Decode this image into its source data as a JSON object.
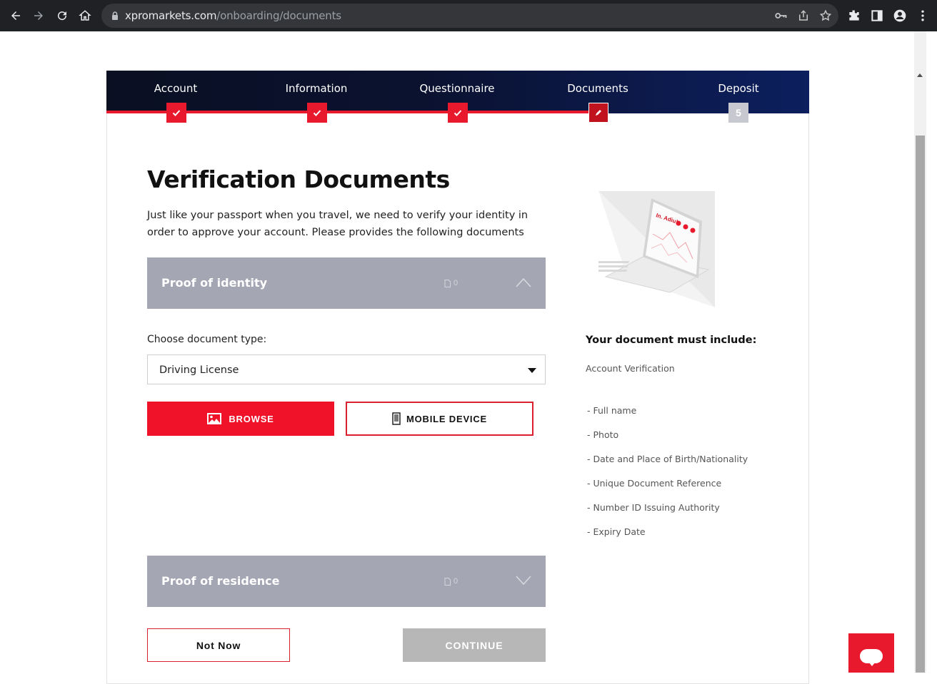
{
  "browser": {
    "url_host": "xpromarkets.com",
    "url_path": "/onboarding/documents"
  },
  "steps": [
    {
      "label": "Account",
      "status": "done"
    },
    {
      "label": "Information",
      "status": "done"
    },
    {
      "label": "Questionnaire",
      "status": "done"
    },
    {
      "label": "Documents",
      "status": "active"
    },
    {
      "label": "Deposit",
      "status": "pending",
      "number": "5"
    }
  ],
  "page": {
    "title": "Verification Documents",
    "intro": "Just like your passport when you travel, we need to verify your identity in order to approve your account. Please provides the following documents"
  },
  "identity": {
    "title": "Proof of identity",
    "count": "0",
    "doc_type_label": "Choose document type:",
    "doc_type_value": "Driving License",
    "browse_label": "BROWSE",
    "mobile_label": "MOBILE DEVICE"
  },
  "residence": {
    "title": "Proof of residence",
    "count": "0"
  },
  "actions": {
    "not_now": "Not Now",
    "continue": "CONTINUE"
  },
  "requirements": {
    "title": "Your document must include:",
    "subtitle": "Account Verification",
    "items": [
      "- Full name",
      "- Photo",
      "- Date and Place of Birth/Nationality",
      "- Unique Document Reference",
      "- Number ID Issuing Authority",
      "- Expiry Date"
    ]
  },
  "colors": {
    "accent": "#e8192c",
    "nav_bg": "#0b1230",
    "accordion_bg": "#a5a6b3",
    "disabled_btn": "#b7b7b7"
  },
  "icons": [
    "back-icon",
    "forward-icon",
    "reload-icon",
    "home-icon",
    "lock-icon",
    "key-icon",
    "share-icon",
    "star-icon",
    "extensions-icon",
    "sidepanel-icon",
    "profile-icon",
    "menu-icon",
    "check-icon",
    "pencil-icon",
    "file-icon",
    "chevron-up-icon",
    "chevron-down-icon",
    "image-icon",
    "phone-icon",
    "chat-icon"
  ]
}
